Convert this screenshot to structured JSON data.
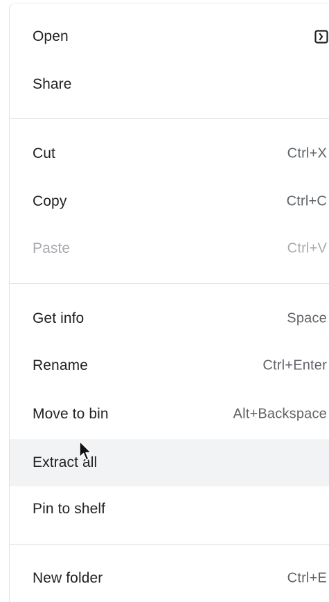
{
  "menu": {
    "open": {
      "label": "Open",
      "icon": "open-with-icon"
    },
    "share": {
      "label": "Share"
    },
    "cut": {
      "label": "Cut",
      "shortcut": "Ctrl+X"
    },
    "copy": {
      "label": "Copy",
      "shortcut": "Ctrl+C"
    },
    "paste": {
      "label": "Paste",
      "shortcut": "Ctrl+V",
      "disabled": true
    },
    "get_info": {
      "label": "Get info",
      "shortcut": "Space"
    },
    "rename": {
      "label": "Rename",
      "shortcut": "Ctrl+Enter"
    },
    "move_to_bin": {
      "label": "Move to bin",
      "shortcut": "Alt+Backspace"
    },
    "extract_all": {
      "label": "Extract all",
      "hovered": true
    },
    "pin_to_shelf": {
      "label": "Pin to shelf"
    },
    "new_folder": {
      "label": "New folder",
      "shortcut": "Ctrl+E"
    }
  },
  "colors": {
    "text": "#202124",
    "shortcut": "#5f6368",
    "disabled": "#a8abaf",
    "hover_bg": "#f1f3f4",
    "separator": "#dadce0"
  }
}
